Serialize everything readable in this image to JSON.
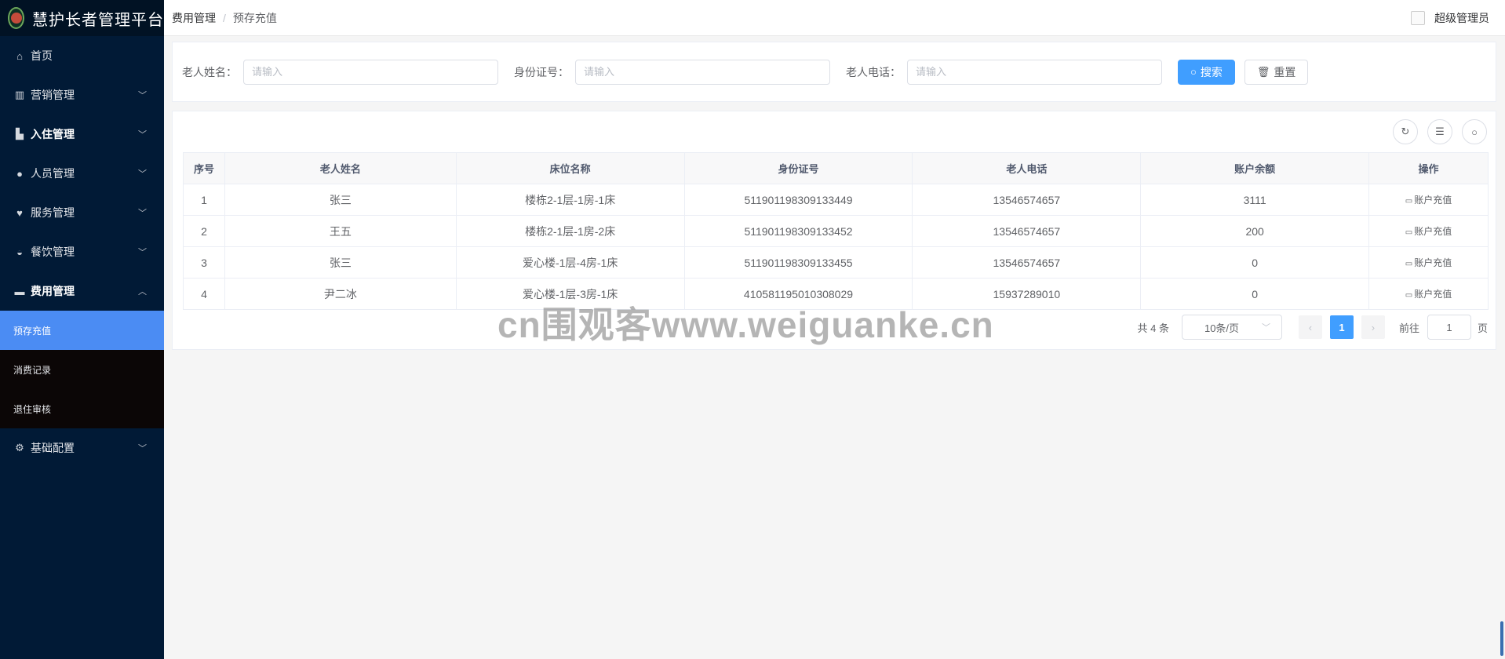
{
  "app": {
    "title": "慧护长者管理平台"
  },
  "sidebar": {
    "items": [
      {
        "label": "首页",
        "icon": "home-icon",
        "has_arrow": false
      },
      {
        "label": "营销管理",
        "icon": "chart-icon",
        "has_arrow": true,
        "arrow": "⌄"
      },
      {
        "label": "入住管理",
        "icon": "building-icon",
        "has_arrow": true,
        "arrow": "⌄"
      },
      {
        "label": "人员管理",
        "icon": "user-icon",
        "has_arrow": true,
        "arrow": "⌄"
      },
      {
        "label": "服务管理",
        "icon": "heart-hand-icon",
        "has_arrow": true,
        "arrow": "⌄"
      },
      {
        "label": "餐饮管理",
        "icon": "bowl-icon",
        "has_arrow": true,
        "arrow": "⌄"
      },
      {
        "label": "费用管理",
        "icon": "card-icon",
        "has_arrow": true,
        "arrow": "⌃"
      }
    ],
    "sub_items": [
      {
        "label": "预存充值",
        "active": true
      },
      {
        "label": "消费记录",
        "active": false
      },
      {
        "label": "退住审核",
        "active": false
      }
    ],
    "footer_item": {
      "label": "基础配置",
      "icon": "gear-icon",
      "arrow": "⌄"
    }
  },
  "header": {
    "breadcrumb": [
      "费用管理",
      "预存充值"
    ],
    "separator": "/",
    "user_name": "超级管理员"
  },
  "search": {
    "fields": [
      {
        "label": "老人姓名：",
        "placeholder": "请输入"
      },
      {
        "label": "身份证号：",
        "placeholder": "请输入"
      },
      {
        "label": "老人电话：",
        "placeholder": "请输入"
      }
    ],
    "search_label": "搜索",
    "reset_label": "重置"
  },
  "table": {
    "columns": [
      "序号",
      "老人姓名",
      "床位名称",
      "身份证号",
      "老人电话",
      "账户余额",
      "操作"
    ],
    "rows": [
      [
        "1",
        "张三",
        "楼栋2-1层-1房-1床",
        "511901198309133449",
        "13546574657",
        "3111"
      ],
      [
        "2",
        "王五",
        "楼栋2-1层-1房-2床",
        "511901198309133452",
        "13546574657",
        "200"
      ],
      [
        "3",
        "张三",
        "爱心楼-1层-4房-1床",
        "511901198309133455",
        "13546574657",
        "0"
      ],
      [
        "4",
        "尹二冰",
        "爱心楼-1层-3房-1床",
        "410581195010308029",
        "15937289010",
        "0"
      ]
    ],
    "action_label": "账户充值"
  },
  "pagination": {
    "total_text": "共 4 条",
    "page_size": "10条/页",
    "current_page": "1",
    "goto_label": "前往",
    "goto_value": "1",
    "page_suffix": "页"
  },
  "watermark": "cn围观客www.weiguanke.cn",
  "colors": {
    "sidebar_bg": "#011a36",
    "active_item": "#4b8cf3",
    "primary": "#409eff"
  }
}
